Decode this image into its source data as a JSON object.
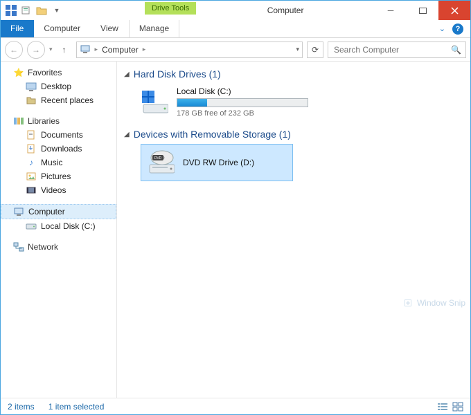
{
  "window": {
    "title": "Computer",
    "context_tab": "Drive Tools"
  },
  "ribbon": {
    "file": "File",
    "tabs": [
      "Computer",
      "View",
      "Manage"
    ]
  },
  "address": {
    "crumb": "Computer"
  },
  "search": {
    "placeholder": "Search Computer"
  },
  "sidebar": {
    "favorites": {
      "label": "Favorites",
      "items": [
        "Desktop",
        "Recent places"
      ]
    },
    "libraries": {
      "label": "Libraries",
      "items": [
        "Documents",
        "Downloads",
        "Music",
        "Pictures",
        "Videos"
      ]
    },
    "computer": {
      "label": "Computer",
      "items": [
        "Local Disk (C:)"
      ]
    },
    "network": {
      "label": "Network"
    }
  },
  "sections": {
    "hdd": {
      "title": "Hard Disk Drives (1)",
      "drive": {
        "name": "Local Disk (C:)",
        "free_text": "178 GB free of 232 GB",
        "used_pct": 23
      }
    },
    "removable": {
      "title": "Devices with Removable Storage (1)",
      "drive": {
        "name": "DVD RW Drive (D:)"
      }
    }
  },
  "status": {
    "count": "2 items",
    "selected": "1 item selected"
  },
  "snip": "Window Snip"
}
